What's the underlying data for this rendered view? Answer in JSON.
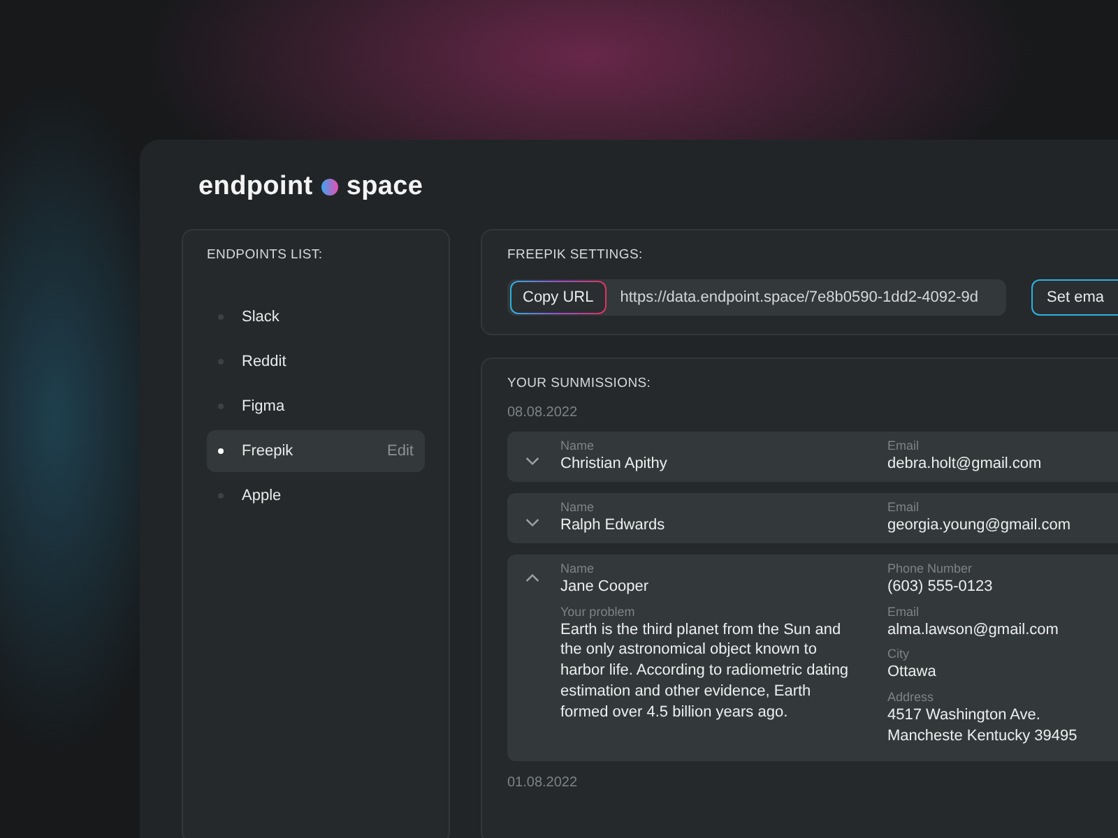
{
  "logo": {
    "words": [
      "endpoint",
      "space"
    ]
  },
  "sidebar": {
    "title": "ENDPOINTS LIST:",
    "items": [
      {
        "name": "Slack",
        "selected": false
      },
      {
        "name": "Reddit",
        "selected": false
      },
      {
        "name": "Figma",
        "selected": false
      },
      {
        "name": "Freepik",
        "selected": true,
        "action": "Edit"
      },
      {
        "name": "Apple",
        "selected": false
      }
    ]
  },
  "settings": {
    "title": "FREEPIK SETTINGS:",
    "copy_button": "Copy URL",
    "url": "https://data.endpoint.space/7e8b0590-1dd2-4092-9d",
    "email_button": "Set ema"
  },
  "submissions": {
    "title": "YOUR SUNMISSIONS:",
    "groups": [
      {
        "date": "08.08.2022",
        "entries": [
          {
            "expanded": false,
            "left": [
              {
                "label": "Name",
                "value": "Christian Apithy"
              }
            ],
            "right": [
              {
                "label": "Email",
                "value": "debra.holt@gmail.com"
              }
            ]
          },
          {
            "expanded": false,
            "left": [
              {
                "label": "Name",
                "value": "Ralph Edwards"
              }
            ],
            "right": [
              {
                "label": "Email",
                "value": "georgia.young@gmail.com"
              }
            ]
          },
          {
            "expanded": true,
            "left": [
              {
                "label": "Name",
                "value": "Jane Cooper"
              },
              {
                "label": "Your problem",
                "value": "Earth is the third planet from the Sun and the only astronomical object known to harbor life. According to radiometric dating estimation and other evidence, Earth formed over 4.5 billion years ago."
              }
            ],
            "right": [
              {
                "label": "Phone Number",
                "value": "(603) 555-0123"
              },
              {
                "label": "Email",
                "value": "alma.lawson@gmail.com"
              },
              {
                "label": "City",
                "value": "Ottawa"
              },
              {
                "label": "Address",
                "value": "4517 Washington Ave. Mancheste Kentucky 39495"
              }
            ]
          }
        ]
      },
      {
        "date": "01.08.2022"
      }
    ]
  }
}
